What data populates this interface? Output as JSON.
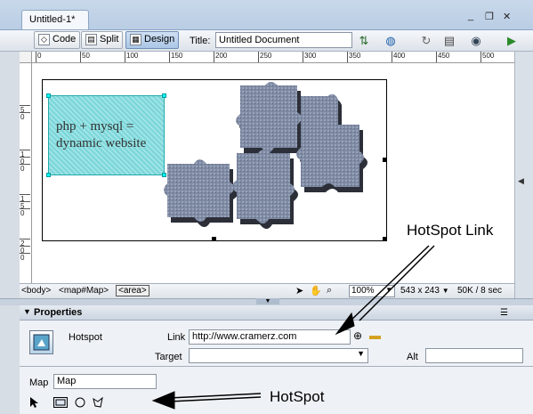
{
  "document": {
    "tab_title": "Untitled-1*"
  },
  "window_controls": {
    "minimize": "_",
    "restore": "❐",
    "close": "✕"
  },
  "toolbar": {
    "code_label": "Code",
    "split_label": "Split",
    "design_label": "Design",
    "title_label": "Title:",
    "title_value": "Untitled Document"
  },
  "ruler": {
    "h_marks": [
      "0",
      "50",
      "100",
      "150",
      "200",
      "250",
      "300",
      "350",
      "400",
      "450",
      "500"
    ],
    "v_marks": [
      "5",
      "0",
      "1",
      "0",
      "0",
      "1",
      "5",
      "0",
      "2",
      "0",
      "0"
    ]
  },
  "image": {
    "hotspot_text": "php + mysql = dynamic website"
  },
  "statusbar": {
    "tags": [
      "<body>",
      "<map#Map>",
      "<area>"
    ],
    "zoom": "100%",
    "dimensions": "543 x 243",
    "size": "50K / 8 sec"
  },
  "properties": {
    "title": "Properties",
    "type_label": "Hotspot",
    "link_label": "Link",
    "link_value": "http://www.cramerz.com",
    "target_label": "Target",
    "target_value": "",
    "alt_label": "Alt",
    "alt_value": "",
    "map_label": "Map",
    "map_value": "Map"
  },
  "annotations": {
    "hotspot_link": "HotSpot Link",
    "hotspot": "HotSpot"
  },
  "colors": {
    "hotspot_fill": "#7ad5d8",
    "selected_button": "#aac6e6",
    "panel_bg": "#eef1f5"
  }
}
